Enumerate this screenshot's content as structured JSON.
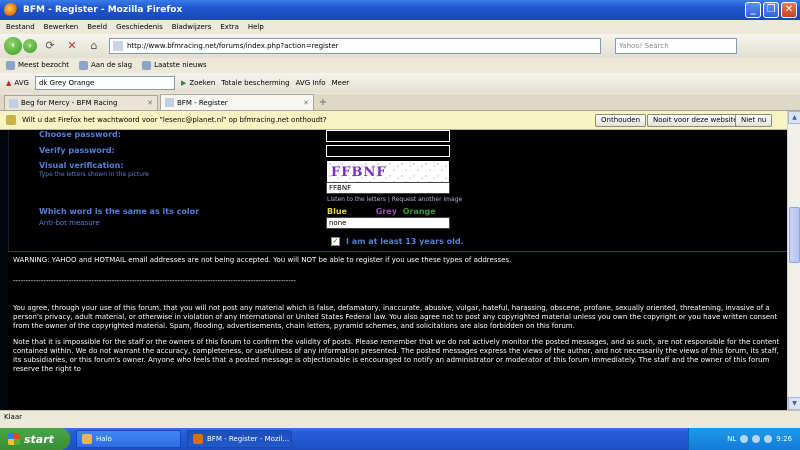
{
  "window": {
    "title": "BFM - Register - Mozilla Firefox",
    "controls": [
      "_",
      "❐",
      "✕"
    ]
  },
  "menubar": [
    "Bestand",
    "Bewerken",
    "Beeld",
    "Geschiedenis",
    "Bladwijzers",
    "Extra",
    "Help"
  ],
  "navbar": {
    "url": "http://www.bfmracing.net/forums/index.php?action=register",
    "search_placeholder": "Yahoo! Search"
  },
  "bookmarks": [
    "Meest bezocht",
    "Aan de slag",
    "Laatste nieuws"
  ],
  "toolbar2": {
    "avg": "AVG",
    "search_value": "dk Grey Orange",
    "zoeken": "Zoeken",
    "totale": "Totale bescherming",
    "avginfo": "AVG Info",
    "meer": "Meer"
  },
  "tabs": [
    {
      "label": "Beg for Mercy - BFM Racing",
      "active": false
    },
    {
      "label": "BFM - Register",
      "active": true
    }
  ],
  "notification": {
    "text": "Wilt u dat Firefox het wachtwoord voor \"lesenc@planet.nl\" op bfmracing.net onthoudt?",
    "buttons": [
      "Onthouden",
      "Nooit voor deze website",
      "Niet nu"
    ]
  },
  "form": {
    "choose_password": "Choose password:",
    "verify_password": "Verify password:",
    "visual_verification": "Visual verification:",
    "visual_sub": "Type the letters shown in the picture",
    "captcha_text": "FFBNF",
    "captcha_input": "FFBNF",
    "listen": "Listen to the letters",
    "separator": "|",
    "request": "Request another image",
    "color_question": "Which word is the same as its color",
    "antibot": "Anti-bot measure",
    "color_words": [
      {
        "word": "Blue",
        "color": "#e5d34a"
      },
      {
        "word": "Grey",
        "color": "#9a4fb3"
      },
      {
        "word": "Orange",
        "color": "#3f9d3a"
      }
    ],
    "color_answer": "none",
    "age_check": "I am at least 13 years old."
  },
  "rules": {
    "warning": "WARNING:  YAHOO and HOTMAIL email addresses are not being accepted.  You will NOT be able to register if you use these types of addresses.",
    "dashes": "----------------------------------------------------------------------------------------------------------------",
    "p1": "You agree, through your use of this forum, that you will not post any material which is false, defamatory, inaccurate, abusive, vulgar, hateful, harassing, obscene, profane, sexually oriented, threatening, invasive of a person's privacy, adult material, or otherwise in violation of any International or United States Federal law. You also agree not to post any copyrighted material unless you own the copyright or you have written consent from the owner of the copyrighted material. Spam, flooding, advertisements, chain letters, pyramid schemes, and solicitations are also forbidden on this forum.",
    "p2": "Note that it is impossible for the staff or the owners of this forum to confirm the validity of posts. Please remember that we do not actively monitor the posted messages, and as such, are not responsible for the content contained within. We do not warrant the accuracy, completeness, or usefulness of any information presented. The posted messages express the views of the author, and not necessarily the views of this forum, its staff, its subsidiaries, or this forum's owner. Anyone who feels that a posted message is objectionable is encouraged to notify an administrator or moderator of this forum immediately. The staff and the owner of this forum reserve the right to"
  },
  "statusbar": {
    "text": "Klaar"
  },
  "taskbar": {
    "start": "start",
    "tasks": [
      {
        "label": "Halo",
        "active": false
      },
      {
        "label": "BFM - Register - Mozil...",
        "active": true
      }
    ],
    "lang": "NL",
    "clock": "9:26"
  }
}
